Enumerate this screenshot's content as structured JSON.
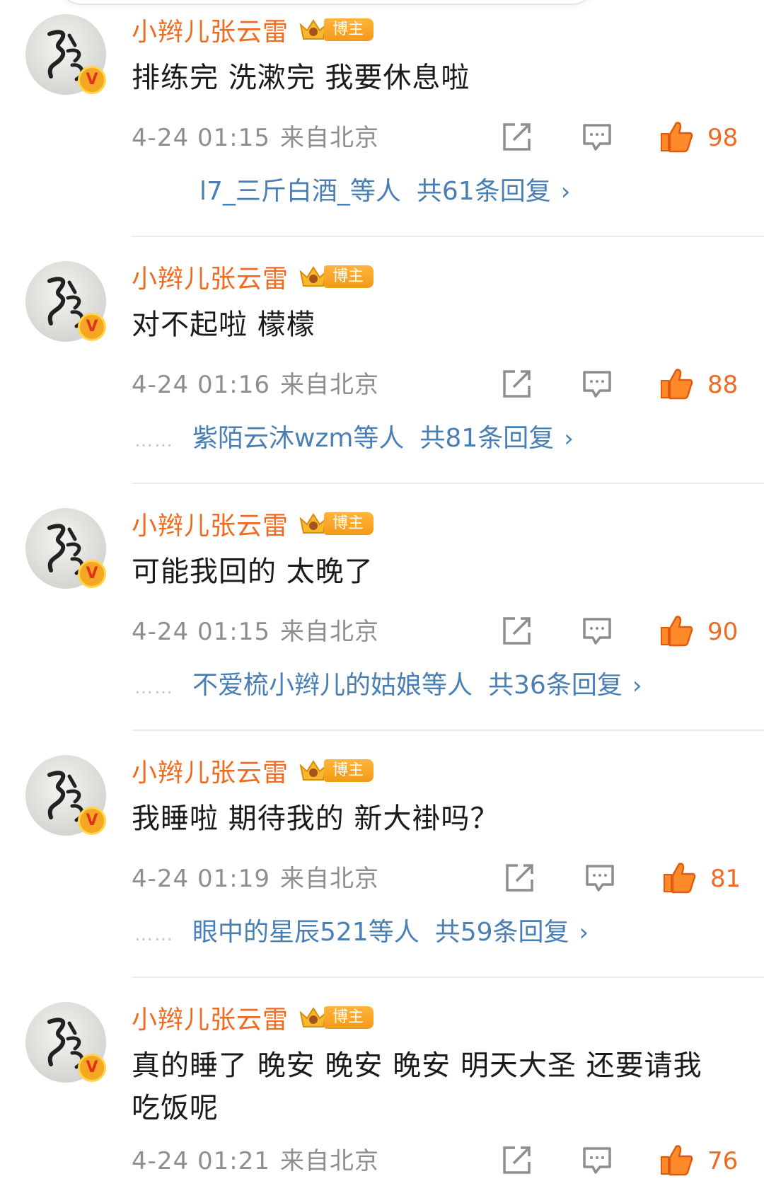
{
  "comments": [
    {
      "author": "小辫儿张云雷",
      "badge": "博主",
      "verified": "V",
      "text": "排练完 洗漱完 我要休息啦",
      "time": "4-24 01:15",
      "location": "来自北京",
      "likes": "98",
      "replies_prefix": "",
      "replies_users": "l7_三斤白酒_等人",
      "replies_count": "共61条回复"
    },
    {
      "author": "小辫儿张云雷",
      "badge": "博主",
      "verified": "V",
      "text": "对不起啦 檬檬",
      "time": "4-24 01:16",
      "location": "来自北京",
      "likes": "88",
      "replies_prefix": "……",
      "replies_users": "紫陌云沐wzm等人",
      "replies_count": "共81条回复"
    },
    {
      "author": "小辫儿张云雷",
      "badge": "博主",
      "verified": "V",
      "text": "可能我回的 太晚了",
      "time": "4-24 01:15",
      "location": "来自北京",
      "likes": "90",
      "replies_prefix": "……",
      "replies_users": "不爱梳小辫儿的姑娘等人",
      "replies_count": "共36条回复"
    },
    {
      "author": "小辫儿张云雷",
      "badge": "博主",
      "verified": "V",
      "text": "我睡啦 期待我的 新大褂吗？",
      "time": "4-24 01:19",
      "location": "来自北京",
      "likes": "81",
      "replies_prefix": "……",
      "replies_users": "眼中的星辰521等人",
      "replies_count": "共59条回复"
    },
    {
      "author": "小辫儿张云雷",
      "badge": "博主",
      "verified": "V",
      "text": "真的睡了 晚安 晚安 晚安 明天大圣 还要请我吃饭呢",
      "time": "4-24 01:21",
      "location": "来自北京",
      "likes": "76"
    }
  ],
  "colors": {
    "username": "#f06a1f",
    "like": "#f06a1f",
    "reply_link": "#4a7fb5",
    "meta": "#8e8e8e",
    "badge_bg": "#f5a623"
  },
  "icons": {
    "share": "share-icon",
    "comment": "comment-icon",
    "like": "like-icon",
    "crown": "crown-icon"
  }
}
